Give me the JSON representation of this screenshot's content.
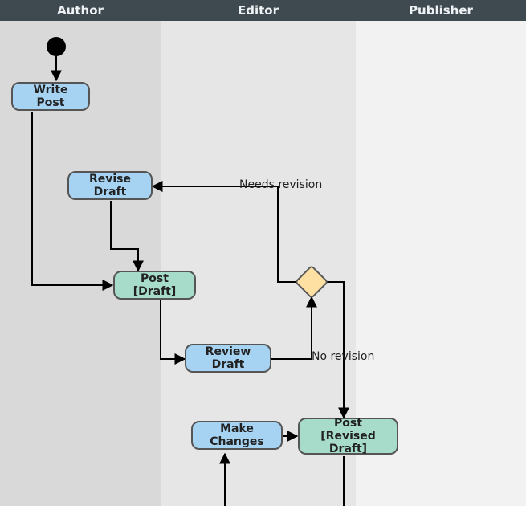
{
  "swimlanes": {
    "author": "Author",
    "editor": "Editor",
    "publisher": "Publisher"
  },
  "nodes": {
    "write_post": "Write Post",
    "revise_draft": "Revise Draft",
    "post_draft": "Post [Draft]",
    "review_draft": "Review Draft",
    "make_changes": "Make Changes",
    "post_revised_draft_line1": "Post",
    "post_revised_draft_line2": "[Revised Draft]"
  },
  "edges": {
    "needs_revision": "Needs revision",
    "no_revision": "No revision"
  },
  "colors": {
    "header_bg": "#3f4a50",
    "lane1": "#d9d9d9",
    "lane2": "#e6e6e6",
    "lane3": "#f2f2f2",
    "activity_blue": "#a7d3f3",
    "activity_green": "#a7dccb",
    "decision_fill": "#ffe0a3"
  }
}
